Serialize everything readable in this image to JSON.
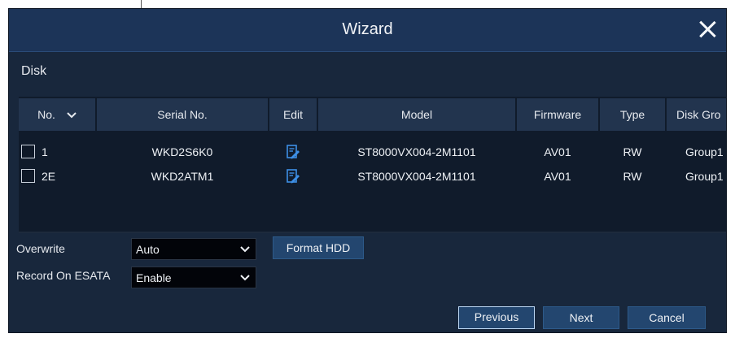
{
  "window": {
    "title": "Wizard"
  },
  "section_title": "Disk",
  "table": {
    "columns": [
      "No.",
      "Serial No.",
      "Edit",
      "Model",
      "Firmware",
      "Type",
      "Disk Gro"
    ],
    "rows": [
      {
        "no": "1",
        "serial": "WKD2S6K0",
        "model": "ST8000VX004-2M1101",
        "firmware": "AV01",
        "type": "RW",
        "group": "Group1"
      },
      {
        "no": "2E",
        "serial": "WKD2ATM1",
        "model": "ST8000VX004-2M1101",
        "firmware": "AV01",
        "type": "RW",
        "group": "Group1"
      }
    ]
  },
  "overwrite": {
    "label": "Overwrite",
    "value": "Auto"
  },
  "record_esata": {
    "label": "Record On ESATA",
    "value": "Enable"
  },
  "format_button": "Format HDD",
  "footer": {
    "previous": "Previous",
    "next": "Next",
    "cancel": "Cancel"
  },
  "colors": {
    "panel": "#18273c",
    "titlebar": "#1c3458",
    "button": "#23466f",
    "edit_icon": "#3d8fe6"
  },
  "icons": {
    "close": "close-icon",
    "sort": "chevron-down-icon",
    "edit": "edit-icon",
    "dropdown": "chevron-down-icon"
  }
}
